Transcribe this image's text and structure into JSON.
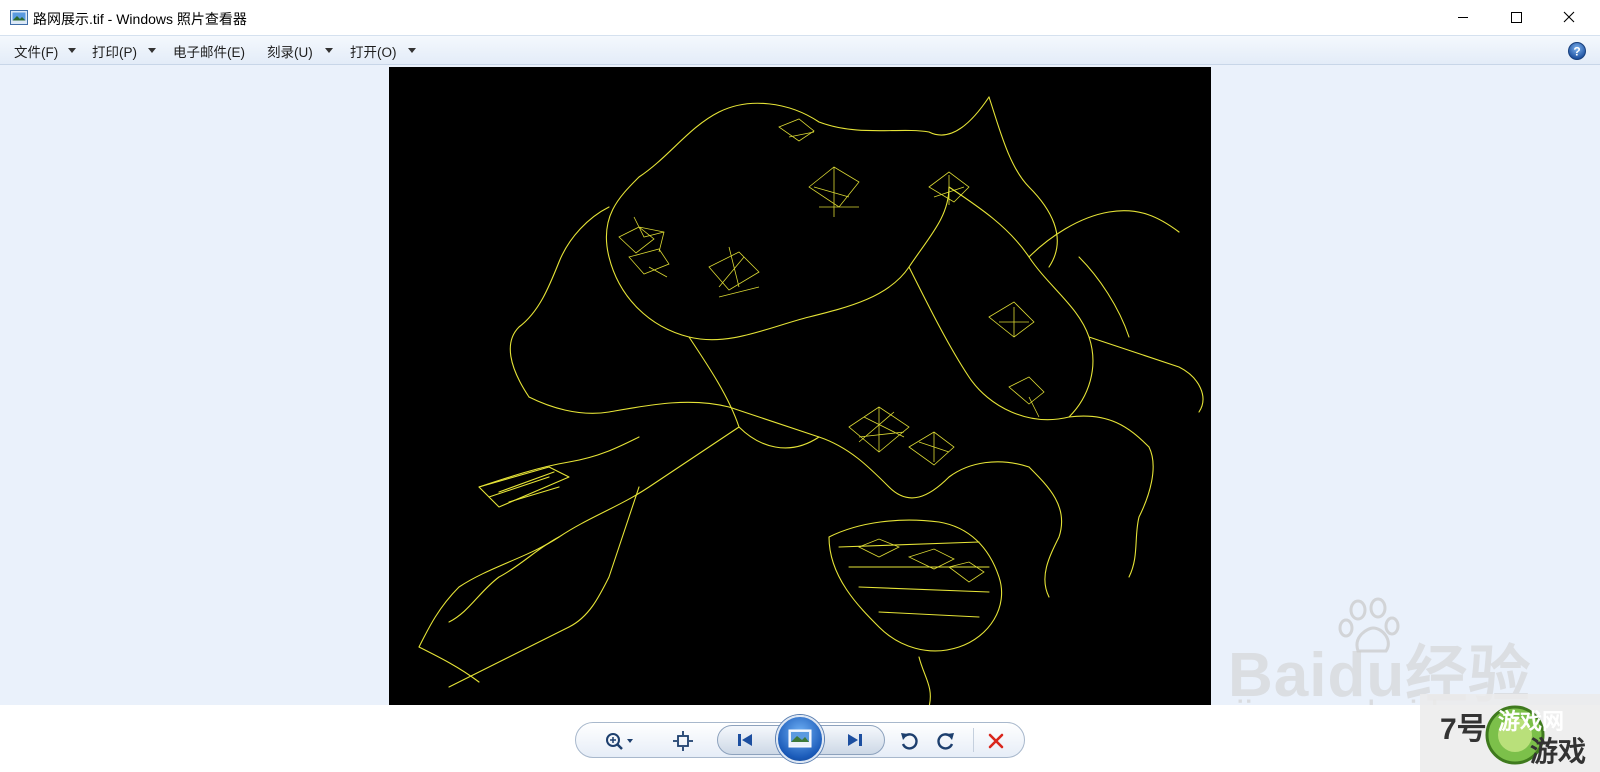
{
  "window": {
    "title": "路网展示.tif - Windows 照片查看器",
    "icon": "photo-viewer-app-icon",
    "controls": [
      "minimize-icon",
      "maximize-icon",
      "close-icon"
    ]
  },
  "menu": {
    "items": [
      {
        "label": "文件(F)",
        "has_dropdown": true
      },
      {
        "label": "打印(P)",
        "has_dropdown": true
      },
      {
        "label": "电子邮件(E)",
        "has_dropdown": false
      },
      {
        "label": "刻录(U)",
        "has_dropdown": true
      },
      {
        "label": "打开(O)",
        "has_dropdown": true
      }
    ],
    "help_icon": "help-icon"
  },
  "image": {
    "description_colors": {
      "background": "#000000",
      "roads": "#f2f03a"
    }
  },
  "toolbar": {
    "buttons": [
      "zoom-icon",
      "actual-size-icon",
      "previous-icon",
      "slideshow-icon",
      "next-icon",
      "rotate-counterclockwise-icon",
      "rotate-clockwise-icon",
      "delete-icon"
    ]
  },
  "watermark": {
    "brand": "Bai",
    "brand_suffix": "du",
    "brand_cn": "经验",
    "site": "jingyan.baidu.com",
    "corner_text_1": "7号",
    "corner_text_2": "游戏网",
    "corner_text_3": "游戏"
  },
  "colors": {
    "accent": "#1a5ab8",
    "delete": "#d9261c",
    "menubar": "#e3ecf8",
    "viewer_bg": "#eaf1fb"
  }
}
